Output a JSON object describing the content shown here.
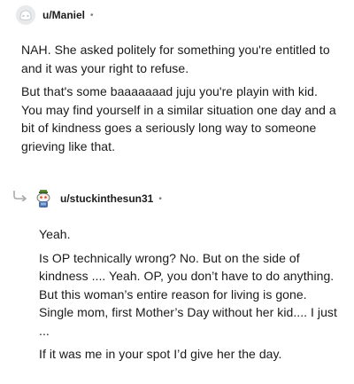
{
  "comment1": {
    "username": "u/Maniel",
    "separator": "•",
    "avatar_icon": "default-avatar-icon",
    "paragraphs": [
      "NAH. She asked politely for something you're entitled to and it was your right to refuse.",
      "But that's some baaaaaaad juju you're playin with kid. You may find yourself in a similar situation one day and a bit of kindness goes a seriously long way to someone grieving like that."
    ]
  },
  "comment2": {
    "username": "u/stuckinthesun31",
    "separator": "•",
    "avatar_icon": "snoo-avatar-icon",
    "reply_icon": "reply-arrow-icon",
    "paragraphs": [
      "Yeah.",
      "Is OP technically wrong? No. But on the side of kindness .... Yeah. OP, you don’t have to do anything. But this woman’s entire reason for living is gone. Single mom, first Mother’s Day without her kid.... I just ...",
      "If it was me in your spot I’d give her the day."
    ]
  },
  "colors": {
    "text": "#1a1a1b",
    "muted": "#7c7c7c",
    "avatar_bg": "#e4e6e8"
  }
}
